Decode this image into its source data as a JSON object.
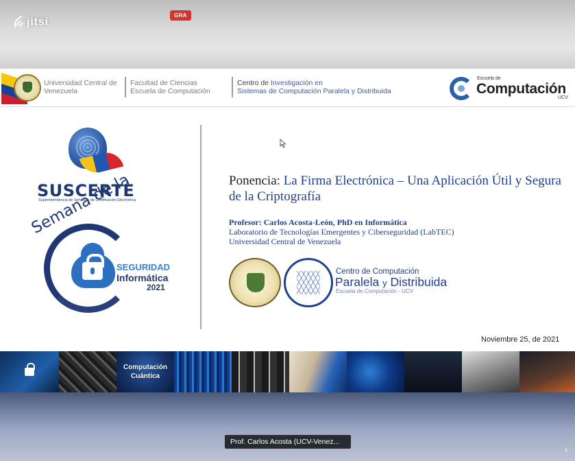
{
  "app": {
    "logo": "jitsi",
    "recording_badge": "GRA"
  },
  "slide": {
    "header": {
      "universidad": "Universidad Central de Venezuela",
      "facultad_l1": "Facultad de Ciencias",
      "facultad_l2": "Escuela de Computación",
      "centro_l1a": "Centro de ",
      "centro_l1b": "Investigación en",
      "centro_l2": "Sistemas de Computación Paralela y Distribuida",
      "escuela_small": "Escuela de",
      "escuela_big": "Computación",
      "escuela_ucv": "UCV"
    },
    "left": {
      "suscerte": "SUSCERTE",
      "suscerte_sub": "Superintendencia de Servicios de Certificación Electrónica",
      "semana": "Semana de la",
      "seguridad": "SEGURIDAD",
      "informatica": "Informática",
      "year": "2021"
    },
    "title_label": "Ponencia:",
    "title_text": "La Firma Electrónica – Una Aplicación Útil y Segura de la Criptografía",
    "profesor": "Profesor: Carlos Acosta-León, PhD en Informática",
    "laboratorio": "Laboratorio de Tecnologías Emergentes y Ciberseguridad (LabTEC)",
    "universidad": "Universidad Central de Venezuela",
    "ccpd_l1": "Centro de Computación",
    "ccpd_l2a": "Paralela",
    "ccpd_y": "y",
    "ccpd_l2b": "Distribuida",
    "ccpd_l3": "Escuela de Computación - UCV",
    "fecha": "Noviembre 25, de 2021",
    "strip": {
      "computacion": "Computación",
      "cuantica": "Cuántica"
    }
  },
  "participant": {
    "name": "Prof. Carlos Acosta (UCV-Venez..."
  },
  "colors": {
    "brand_blue": "#1f3f8f",
    "recording_red": "#d3342f"
  }
}
